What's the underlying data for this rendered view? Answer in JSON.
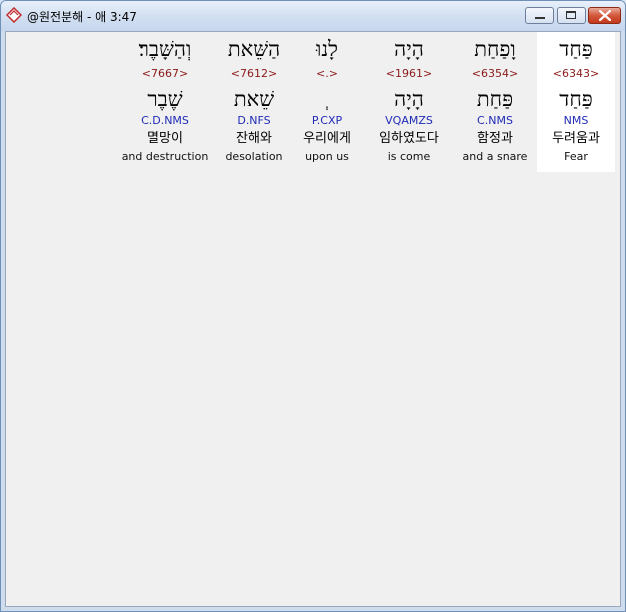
{
  "window": {
    "title": "@원전분해 - 애 3:47"
  },
  "colors": {
    "strong_number": "#8b1a1a",
    "parsing": "#1f2bb5",
    "selected_background": "#ffffff"
  },
  "words": [
    {
      "hebrew": "פַּחַד",
      "strong": "<6343>",
      "lemma": "פַּחַד",
      "parsing": "NMS",
      "korean": "두려움과",
      "english": "Fear",
      "selected": true
    },
    {
      "hebrew": "וָפַחַת",
      "strong": "<6354>",
      "lemma": "פַּחַת",
      "parsing": "C.NMS",
      "korean": "함정과",
      "english": "and a snare",
      "selected": false
    },
    {
      "hebrew": "הָיָה",
      "strong": "<1961>",
      "lemma": "הָיָה",
      "parsing": "VQAMZS",
      "korean": "임하였도다",
      "english": "is come",
      "selected": false
    },
    {
      "hebrew": "לָנוּ",
      "strong": "<.>",
      "lemma": "ְ",
      "parsing": "P.CXP",
      "korean": "우리에게",
      "english": "upon us",
      "selected": false
    },
    {
      "hebrew": "הַשֵּׁאת",
      "strong": "<7612>",
      "lemma": "שֵׁאת",
      "parsing": "D.NFS",
      "korean": "잔해와",
      "english": "desolation",
      "selected": false
    },
    {
      "hebrew": "וְהַשָּׁבֶר׃",
      "strong": "<7667>",
      "lemma": "שֶׁבֶר",
      "parsing": "C.D.NMS",
      "korean": "멸망이",
      "english": "and destruction",
      "selected": false
    }
  ]
}
